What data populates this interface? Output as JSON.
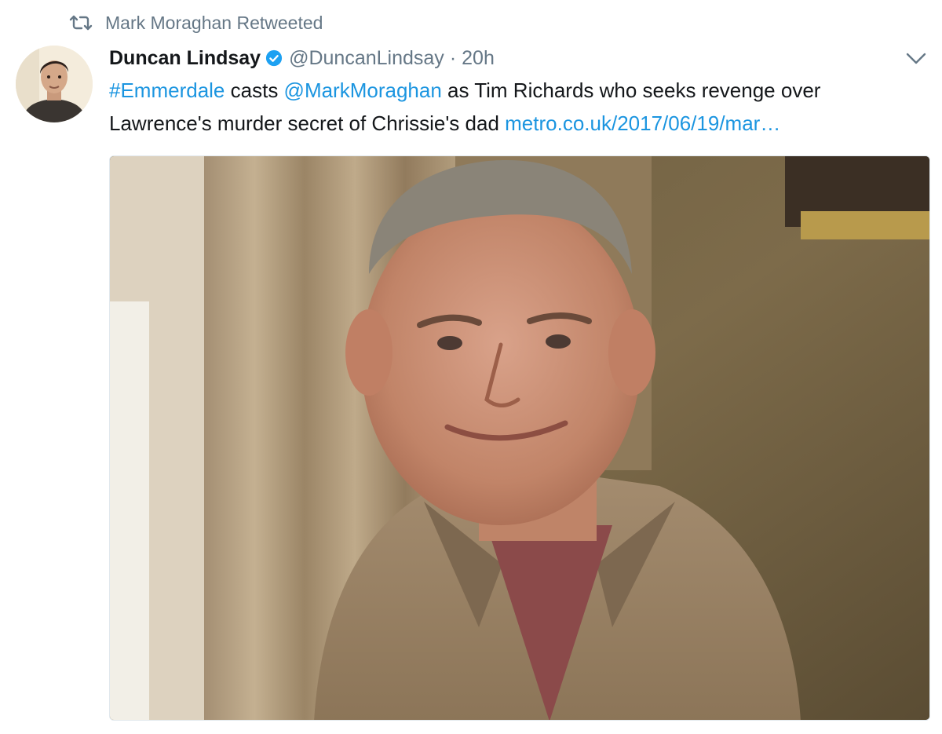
{
  "retweet": {
    "icon": "retweet-icon",
    "text": "Mark Moraghan Retweeted"
  },
  "author": {
    "name": "Duncan Lindsay",
    "verified": true,
    "handle": "@DuncanLindsay",
    "separator": "·",
    "time": "20h"
  },
  "tweet": {
    "hashtag": "#Emmerdale",
    "text_1": " casts ",
    "mention": "@MarkMoraghan",
    "text_2": " as Tim Richards who seeks revenge over Lawrence's murder secret of Chrissie's dad ",
    "url_display": "metro.co.uk/2017/06/19/mar…"
  },
  "colors": {
    "link": "#1b95e0",
    "secondary_text": "#657786",
    "primary_text": "#14171a",
    "verified_badge": "#1da1f2"
  },
  "icons": {
    "retweet": "retweet-icon",
    "verified": "verified-badge-icon",
    "menu": "chevron-down-icon"
  }
}
